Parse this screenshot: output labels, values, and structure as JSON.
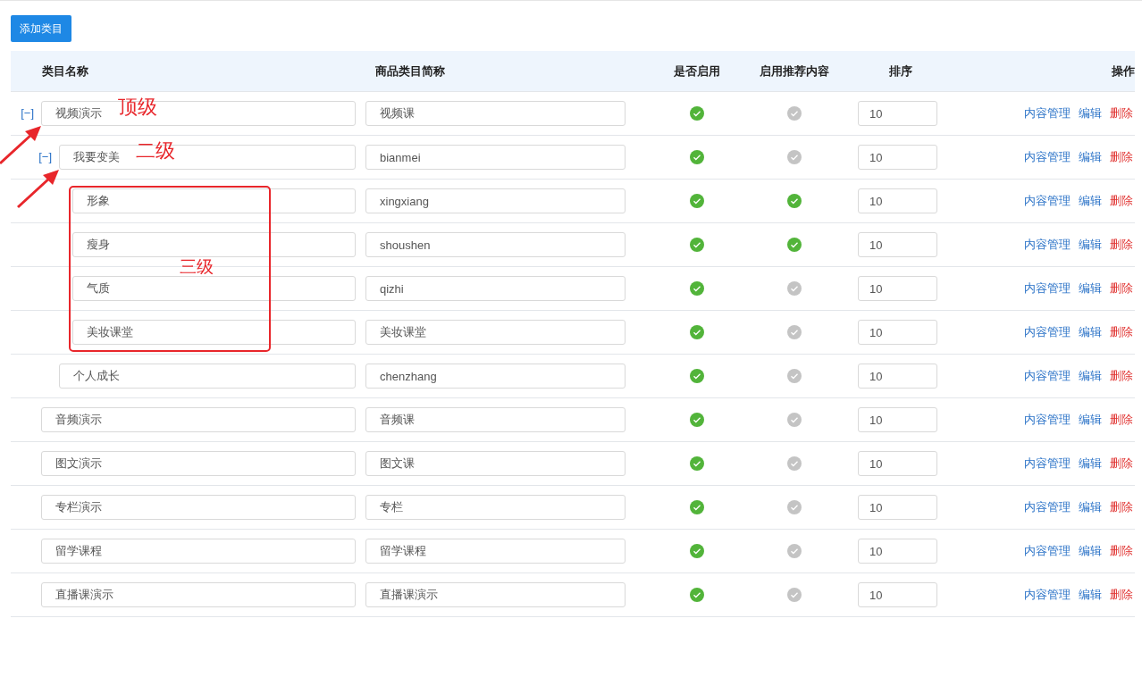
{
  "add_button": "添加类目",
  "columns": [
    "类目名称",
    "商品类目简称",
    "是否启用",
    "启用推荐内容",
    "排序",
    "操作"
  ],
  "rows": [
    {
      "name": "视频演示",
      "short_name": "视频课",
      "enabled": true,
      "recommended": false,
      "sort": "10",
      "expanded": true,
      "toggle": "[−]",
      "note": "顶级",
      "arrow": true,
      "actions": [
        {
          "label": "内容管理",
          "kind": "link"
        },
        {
          "label": "编辑",
          "kind": "link"
        },
        {
          "label": "删除",
          "kind": "danger"
        }
      ],
      "children": [
        {
          "name": "我要变美",
          "short_name": "bianmei",
          "enabled": true,
          "recommended": false,
          "sort": "10",
          "expanded": true,
          "toggle": "[−]",
          "note": "二级",
          "arrow": true,
          "children_note": "三级",
          "actions": [
            {
              "label": "内容管理",
              "kind": "link"
            },
            {
              "label": "编辑",
              "kind": "link"
            },
            {
              "label": "删除",
              "kind": "danger"
            }
          ],
          "children": [
            {
              "name": "形象",
              "short_name": "xingxiang",
              "enabled": true,
              "recommended": true,
              "sort": "10",
              "actions": [
                {
                  "label": "内容管理",
                  "kind": "link"
                },
                {
                  "label": "编辑",
                  "kind": "link"
                },
                {
                  "label": "删除",
                  "kind": "danger"
                }
              ]
            },
            {
              "name": "瘦身",
              "short_name": "shoushen",
              "enabled": true,
              "recommended": true,
              "sort": "10",
              "actions": [
                {
                  "label": "内容管理",
                  "kind": "link"
                },
                {
                  "label": "编辑",
                  "kind": "link"
                },
                {
                  "label": "删除",
                  "kind": "danger"
                }
              ]
            },
            {
              "name": "气质",
              "short_name": "qizhi",
              "enabled": true,
              "recommended": false,
              "sort": "10",
              "actions": [
                {
                  "label": "内容管理",
                  "kind": "link"
                },
                {
                  "label": "编辑",
                  "kind": "link"
                },
                {
                  "label": "删除",
                  "kind": "danger"
                }
              ]
            },
            {
              "name": "美妆课堂",
              "short_name": "美妆课堂",
              "enabled": true,
              "recommended": false,
              "sort": "10",
              "actions": [
                {
                  "label": "内容管理",
                  "kind": "link"
                },
                {
                  "label": "编辑",
                  "kind": "link"
                },
                {
                  "label": "删除",
                  "kind": "danger"
                }
              ]
            }
          ]
        },
        {
          "name": "个人成长",
          "short_name": "chenzhang",
          "enabled": true,
          "recommended": false,
          "sort": "10",
          "actions": [
            {
              "label": "内容管理",
              "kind": "link"
            },
            {
              "label": "编辑",
              "kind": "link"
            },
            {
              "label": "删除",
              "kind": "danger"
            }
          ]
        }
      ]
    },
    {
      "name": "音频演示",
      "short_name": "音频课",
      "enabled": true,
      "recommended": false,
      "sort": "10",
      "actions": [
        {
          "label": "内容管理",
          "kind": "link"
        },
        {
          "label": "编辑",
          "kind": "link"
        },
        {
          "label": "删除",
          "kind": "danger"
        }
      ]
    },
    {
      "name": "图文演示",
      "short_name": "图文课",
      "enabled": true,
      "recommended": false,
      "sort": "10",
      "actions": [
        {
          "label": "内容管理",
          "kind": "link"
        },
        {
          "label": "编辑",
          "kind": "link"
        },
        {
          "label": "删除",
          "kind": "danger"
        }
      ]
    },
    {
      "name": "专栏演示",
      "short_name": "专栏",
      "enabled": true,
      "recommended": false,
      "sort": "10",
      "actions": [
        {
          "label": "内容管理",
          "kind": "link"
        },
        {
          "label": "编辑",
          "kind": "link"
        },
        {
          "label": "删除",
          "kind": "danger"
        }
      ]
    },
    {
      "name": "留学课程",
      "short_name": "留学课程",
      "enabled": true,
      "recommended": false,
      "sort": "10",
      "actions": [
        {
          "label": "内容管理",
          "kind": "link"
        },
        {
          "label": "编辑",
          "kind": "link"
        },
        {
          "label": "删除",
          "kind": "danger"
        }
      ]
    },
    {
      "name": "直播课演示",
      "short_name": "直播课演示",
      "enabled": true,
      "recommended": false,
      "sort": "10",
      "actions": [
        {
          "label": "内容管理",
          "kind": "link"
        },
        {
          "label": "编辑",
          "kind": "link"
        },
        {
          "label": "删除",
          "kind": "danger"
        }
      ]
    }
  ]
}
